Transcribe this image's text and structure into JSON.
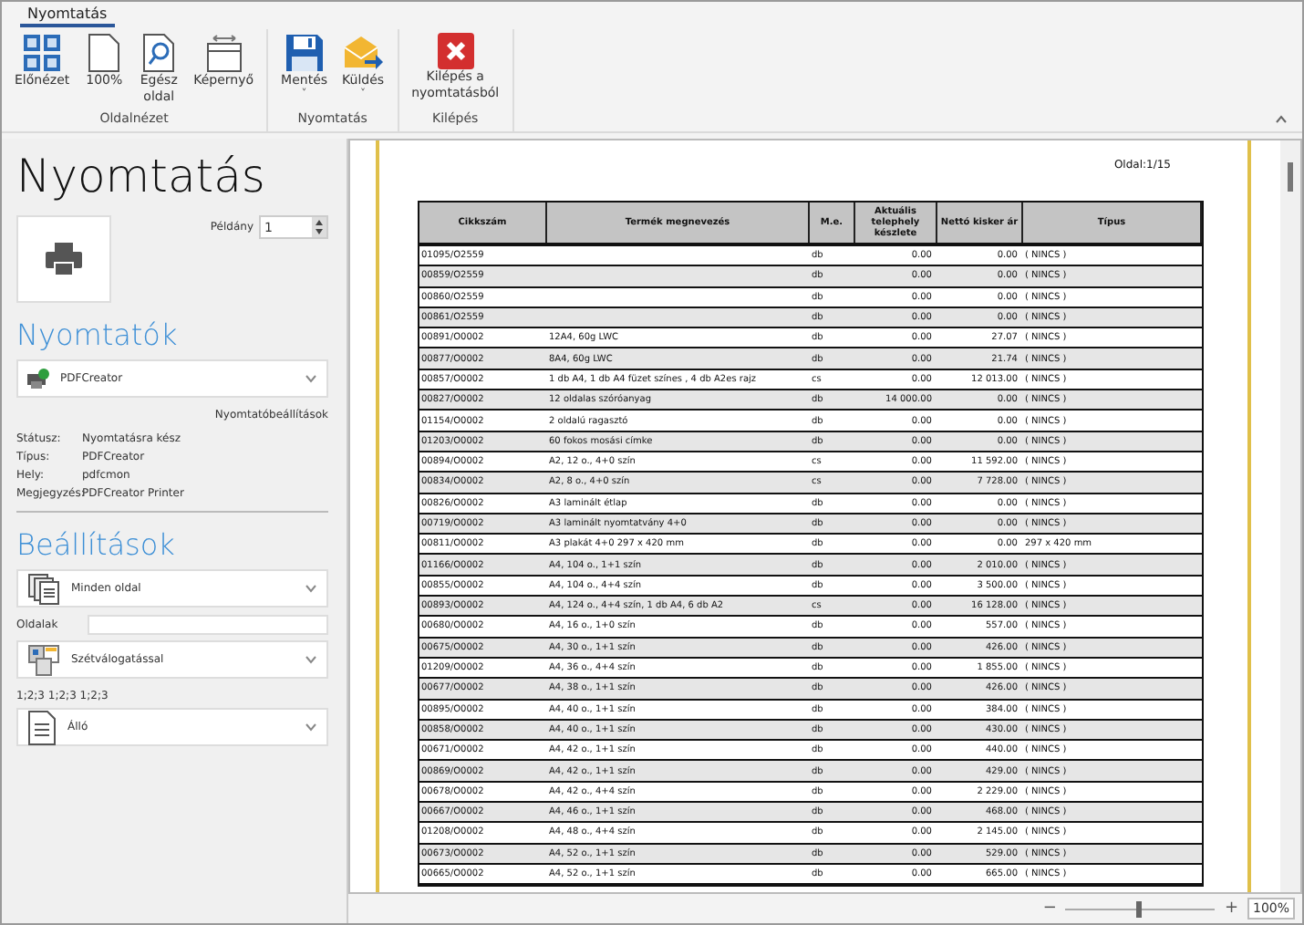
{
  "ribbon": {
    "tabs": [
      {
        "label": "Nyomtatás",
        "selected": true
      }
    ],
    "groups": [
      {
        "label": "Oldalnézet",
        "buttons": [
          {
            "label": "Előnézet"
          },
          {
            "label": "100%"
          },
          {
            "label": "Egész oldal"
          },
          {
            "label": "Képernyő"
          }
        ]
      },
      {
        "label": "Nyomtatás",
        "buttons": [
          {
            "label": "Mentés",
            "caret": "˅"
          },
          {
            "label": "Küldés",
            "caret": "˅"
          }
        ]
      },
      {
        "label": "Kilépés",
        "buttons": [
          {
            "label": "Kilépés a nyomtatásból"
          }
        ]
      }
    ]
  },
  "panel": {
    "title": "Nyomtatás",
    "copies": {
      "label": "Példány",
      "value": "1"
    },
    "printers_heading": "Nyomtatók",
    "printer": "PDFCreator",
    "printer_settings_link": "Nyomtatóbeállítások",
    "info": [
      {
        "label": "Státusz:",
        "value": "Nyomtatásra kész"
      },
      {
        "label": "Típus:",
        "value": "PDFCreator"
      },
      {
        "label": "Hely:",
        "value": "pdfcmon"
      },
      {
        "label": "Megjegyzés:",
        "value": "PDFCreator Printer"
      }
    ],
    "settings_heading": "Beállítások",
    "pages_dropdown": "Minden oldal",
    "pages_label": "Oldalak",
    "collate_dropdown": "Szétválogatással",
    "collate_hint": "1;2;3 1;2;3 1;2;3",
    "orientation_dropdown": "Álló"
  },
  "preview": {
    "page_label": "Oldal:1/15",
    "columns": [
      "Cikkszám",
      "Termék megnevezés",
      "M.e.",
      "Aktuális telephely készlete",
      "Nettó kisker ár",
      "Típus"
    ],
    "rows": [
      [
        "01095/O2559",
        "",
        "db",
        "0.00",
        "0.00",
        "( NINCS )"
      ],
      [
        "00859/O2559",
        "",
        "db",
        "0.00",
        "0.00",
        "( NINCS )"
      ],
      [
        "00860/O2559",
        "",
        "db",
        "0.00",
        "0.00",
        "( NINCS )"
      ],
      [
        "00861/O2559",
        "",
        "db",
        "0.00",
        "0.00",
        "( NINCS )"
      ],
      [
        "00891/O0002",
        "12A4, 60g LWC",
        "db",
        "0.00",
        "27.07",
        "( NINCS )"
      ],
      [
        "00877/O0002",
        "8A4, 60g LWC",
        "db",
        "0.00",
        "21.74",
        "( NINCS )"
      ],
      [
        "00857/O0002",
        "1 db A4, 1 db A4 füzet színes , 4 db A2es rajz",
        "cs",
        "0.00",
        "12 013.00",
        "( NINCS )"
      ],
      [
        "00827/O0002",
        "12 oldalas szóróanyag",
        "db",
        "14 000.00",
        "0.00",
        "( NINCS )"
      ],
      [
        "01154/O0002",
        "2 oldalú ragasztó",
        "db",
        "0.00",
        "0.00",
        "( NINCS )"
      ],
      [
        "01203/O0002",
        "60 fokos mosási címke",
        "db",
        "0.00",
        "0.00",
        "( NINCS )"
      ],
      [
        "00894/O0002",
        "A2, 12 o., 4+0 szín",
        "cs",
        "0.00",
        "11 592.00",
        "( NINCS )"
      ],
      [
        "00834/O0002",
        "A2, 8 o., 4+0 szín",
        "cs",
        "0.00",
        "7 728.00",
        "( NINCS )"
      ],
      [
        "00826/O0002",
        "A3 laminált étlap",
        "db",
        "0.00",
        "0.00",
        "( NINCS )"
      ],
      [
        "00719/O0002",
        "A3 laminált nyomtatvány 4+0",
        "db",
        "0.00",
        "0.00",
        "( NINCS )"
      ],
      [
        "00811/O0002",
        "A3 plakát 4+0 297 x 420 mm",
        "db",
        "0.00",
        "0.00",
        "297 x 420 mm"
      ],
      [
        "01166/O0002",
        "A4, 104 o., 1+1 szín",
        "db",
        "0.00",
        "2 010.00",
        "( NINCS )"
      ],
      [
        "00855/O0002",
        "A4, 104 o., 4+4 szín",
        "db",
        "0.00",
        "3 500.00",
        "( NINCS )"
      ],
      [
        "00893/O0002",
        "A4, 124 o., 4+4 szín, 1 db A4, 6 db A2",
        "cs",
        "0.00",
        "16 128.00",
        "( NINCS )"
      ],
      [
        "00680/O0002",
        "A4, 16 o., 1+0 szín",
        "db",
        "0.00",
        "557.00",
        "( NINCS )"
      ],
      [
        "00675/O0002",
        "A4, 30 o., 1+1 szín",
        "db",
        "0.00",
        "426.00",
        "( NINCS )"
      ],
      [
        "01209/O0002",
        "A4, 36 o., 4+4 szín",
        "db",
        "0.00",
        "1 855.00",
        "( NINCS )"
      ],
      [
        "00677/O0002",
        "A4, 38 o., 1+1 szín",
        "db",
        "0.00",
        "426.00",
        "( NINCS )"
      ],
      [
        "00895/O0002",
        "A4, 40 o., 1+1 szín",
        "db",
        "0.00",
        "384.00",
        "( NINCS )"
      ],
      [
        "00858/O0002",
        "A4, 40 o., 1+1 szín",
        "db",
        "0.00",
        "430.00",
        "( NINCS )"
      ],
      [
        "00671/O0002",
        "A4, 42 o., 1+1 szín",
        "db",
        "0.00",
        "440.00",
        "( NINCS )"
      ],
      [
        "00869/O0002",
        "A4, 42 o., 1+1 szín",
        "db",
        "0.00",
        "429.00",
        "( NINCS )"
      ],
      [
        "00678/O0002",
        "A4, 42 o., 4+4 szín",
        "db",
        "0.00",
        "2 229.00",
        "( NINCS )"
      ],
      [
        "00667/O0002",
        "A4, 46 o., 1+1 szín",
        "db",
        "0.00",
        "468.00",
        "( NINCS )"
      ],
      [
        "01208/O0002",
        "A4, 48 o., 4+4 szín",
        "db",
        "0.00",
        "2 145.00",
        "( NINCS )"
      ],
      [
        "00673/O0002",
        "A4, 52 o., 1+1 szín",
        "db",
        "0.00",
        "529.00",
        "( NINCS )"
      ],
      [
        "00665/O0002",
        "A4, 52 o., 1+1 szín",
        "db",
        "0.00",
        "665.00",
        "( NINCS )"
      ]
    ]
  },
  "status_bar": {
    "zoom_minus": "−",
    "zoom_plus": "+",
    "zoom": {
      "level": 0.48
    },
    "zoom_value": "100%"
  }
}
